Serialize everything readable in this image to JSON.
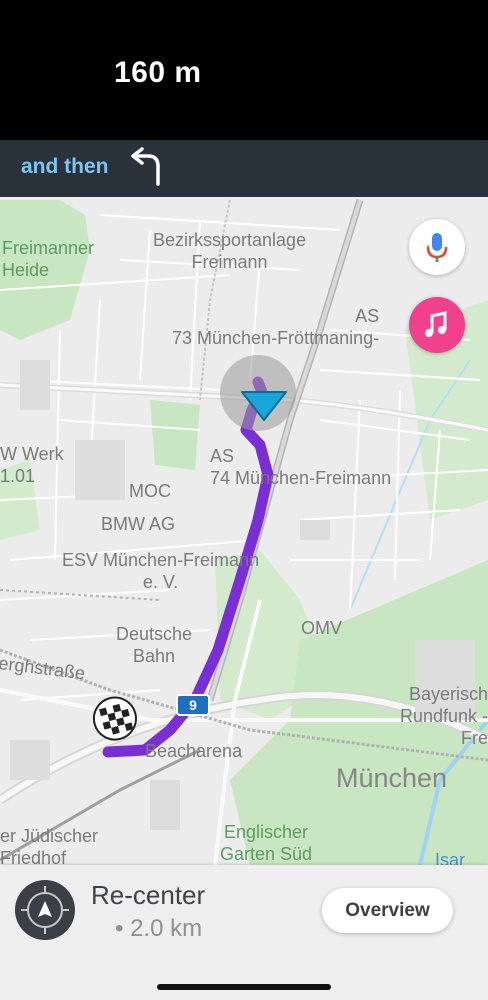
{
  "instruction": {
    "distance": "160 m",
    "then_label": "and then",
    "then_icon": "turn-left-arrow-icon"
  },
  "map": {
    "labels": {
      "freimanner_heide": "Freimanner\nHeide",
      "bezirkssportanlage": "Bezirkssportanlage\nFreimann",
      "as_73": "AS\n73 München-Fröttmaning-",
      "bw_werk": "W Werk\n1.01",
      "as_74": "AS\n74 München-Freimann",
      "moc": "MOC",
      "bmw_ag": "BMW AG",
      "esv": "ESV München-Freimann\ne. V.",
      "deutsche_bahn": "Deutsche\nBahn",
      "omv": "OMV",
      "berghstrasse": "erghstraße",
      "bayerischer_rundfunk": "Bayerisch\nRundfunk - Fre",
      "beacharena": "Beacharena",
      "muenchen": "München",
      "juedischer_friedhof": "er Jüdischer\nFriedhof",
      "englischer_garten": "Englischer\nGarten Süd",
      "isar": "Isar"
    },
    "route_shield": "9",
    "colors": {
      "route": "#7a2fd6",
      "current_position": "#1aa5d9",
      "park": "#c8e6c1",
      "water": "#9fd3f4"
    }
  },
  "buttons": {
    "mic_icon": "microphone-icon",
    "music_icon": "music-note-icon"
  },
  "bottom": {
    "recenter_label": "Re-center",
    "remaining_distance": "• 2.0 km",
    "overview_label": "Overview",
    "recenter_icon": "compass-recenter-icon"
  }
}
